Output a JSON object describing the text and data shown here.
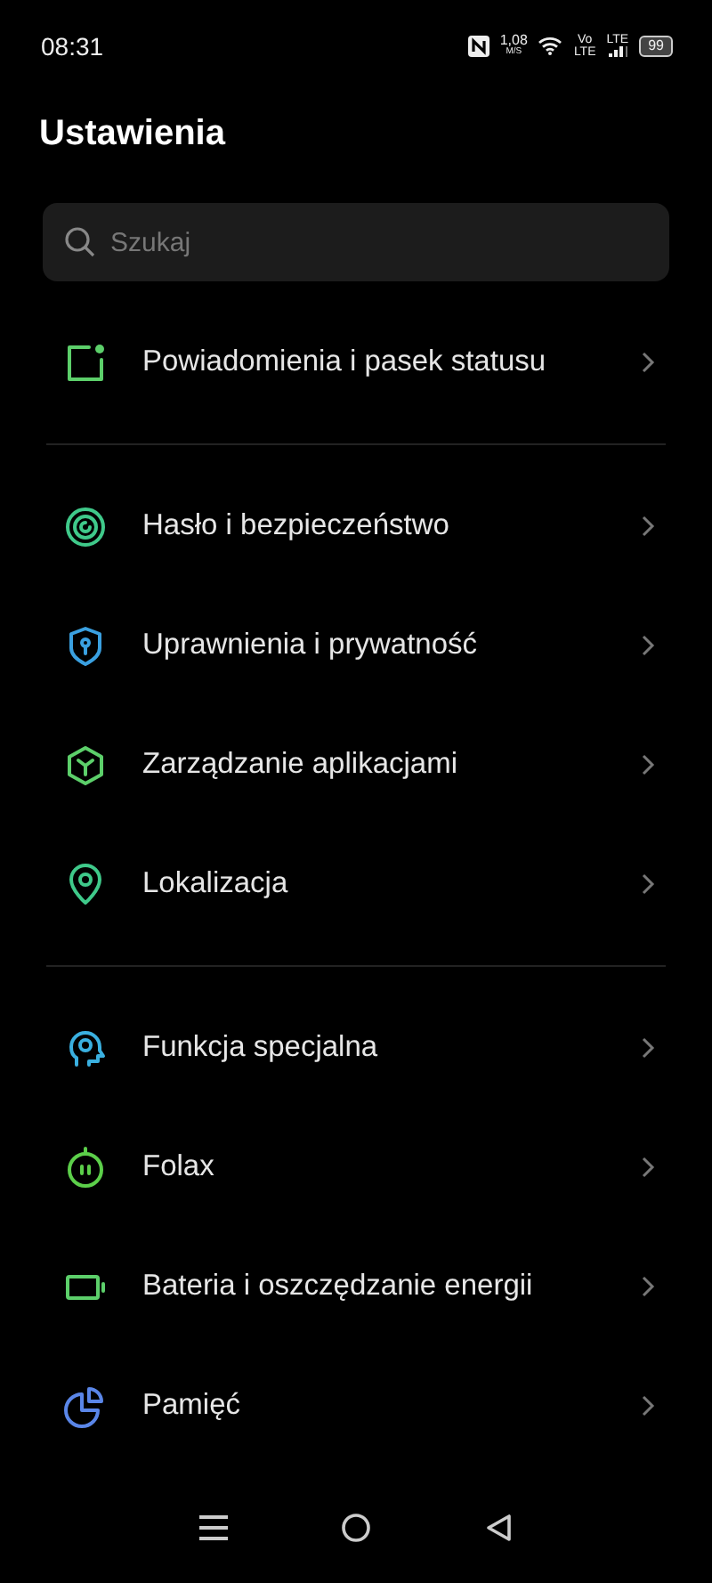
{
  "status_bar": {
    "time": "08:31",
    "speed": "1,08",
    "speed_unit": "M/S",
    "volte_top": "Vo",
    "volte_bottom": "LTE",
    "network": "LTE",
    "battery": "99"
  },
  "title": "Ustawienia",
  "search": {
    "placeholder": "Szukaj"
  },
  "sections": [
    {
      "items": [
        {
          "label": "Powiadomienia i pasek statusu",
          "kind": "notification",
          "color": "#5ccf6a"
        }
      ]
    },
    {
      "items": [
        {
          "label": "Hasło i bezpieczeństwo",
          "kind": "target",
          "color": "#3fc98a"
        },
        {
          "label": "Uprawnienia i prywatność",
          "kind": "shield",
          "color": "#3aa0e0"
        },
        {
          "label": "Zarządzanie aplikacjami",
          "kind": "cube",
          "color": "#5ccf6a"
        },
        {
          "label": "Lokalizacja",
          "kind": "pin",
          "color": "#3fc98a"
        }
      ]
    },
    {
      "items": [
        {
          "label": "Funkcja specjalna",
          "kind": "head",
          "color": "#3ab0e0"
        },
        {
          "label": "Folax",
          "kind": "power",
          "color": "#5ccf4a"
        },
        {
          "label": "Bateria i oszczędzanie energii",
          "kind": "battery",
          "color": "#5ccf6a"
        },
        {
          "label": "Pamięć",
          "kind": "pie",
          "color": "#5a86e8"
        }
      ]
    }
  ]
}
